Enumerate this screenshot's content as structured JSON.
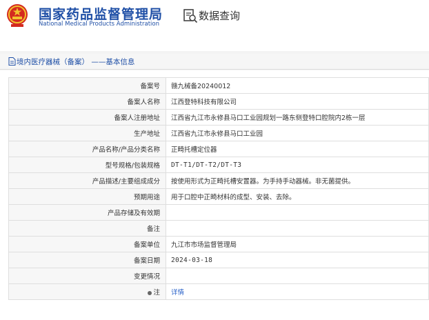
{
  "header": {
    "brand_cn": "国家药品监督管理局",
    "brand_en": "National Medical Products Administration",
    "query_title": "数据查询"
  },
  "breadcrumb": {
    "text": "境内医疗器械（备案） ——基本信息"
  },
  "colors": {
    "brand_blue": "#1f4fa6",
    "link_blue": "#2b63c9",
    "label_bg": "#f7f7f7",
    "border": "#dedede"
  },
  "record": {
    "rows": [
      {
        "label": "备案号",
        "value": "赣九械备20240012"
      },
      {
        "label": "备案人名称",
        "value": "江西登特科技有限公司"
      },
      {
        "label": "备案人注册地址",
        "value": "江西省九江市永修县马口工业园规划一路东侧登特口腔院内2栋一层"
      },
      {
        "label": "生产地址",
        "value": "江西省九江市永修县马口工业园"
      },
      {
        "label": "产品名称/产品分类名称",
        "value": "正畸托槽定位器"
      },
      {
        "label": "型号规格/包装规格",
        "value": "DT-T1/DT-T2/DT-T3"
      },
      {
        "label": "产品描述/主要组成成分",
        "value": "按使用形式为正畸托槽安置器。为手持手动器械。非无菌提供。"
      },
      {
        "label": "预期用途",
        "value": "用于口腔中正畸材料的成型、安装、去除。"
      },
      {
        "label": "产品存储及有效期",
        "value": ""
      },
      {
        "label": "备注",
        "value": ""
      },
      {
        "label": "备案单位",
        "value": "九江市市场监督管理局"
      },
      {
        "label": "备案日期",
        "value": "2024-03-18"
      },
      {
        "label": "变更情况",
        "value": ""
      }
    ],
    "note_label": "注",
    "note_link": "详情"
  }
}
